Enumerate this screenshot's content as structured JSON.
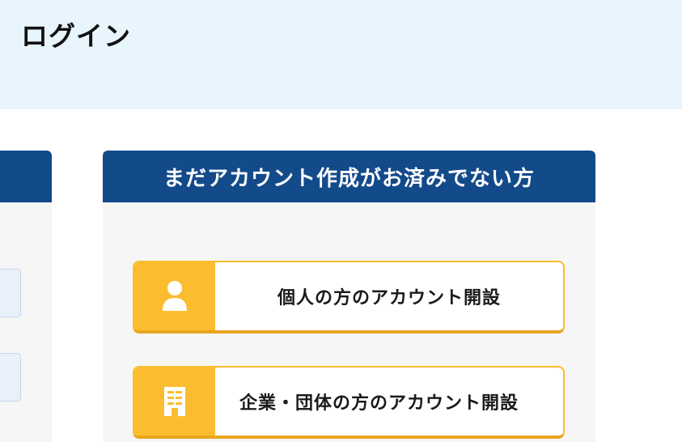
{
  "header": {
    "title": "ログイン"
  },
  "signup_panel": {
    "title": "まだアカウント作成がお済みでない方",
    "buttons": [
      {
        "label": "個人の方のアカウント開設",
        "icon": "person-icon"
      },
      {
        "label": "企業・団体の方のアカウント開設",
        "icon": "building-icon"
      }
    ]
  },
  "colors": {
    "header_bg": "#e8f5fd",
    "panel_header": "#134a8a",
    "panel_bg": "#f6f6f6",
    "accent_yellow": "#fbbd2f"
  }
}
